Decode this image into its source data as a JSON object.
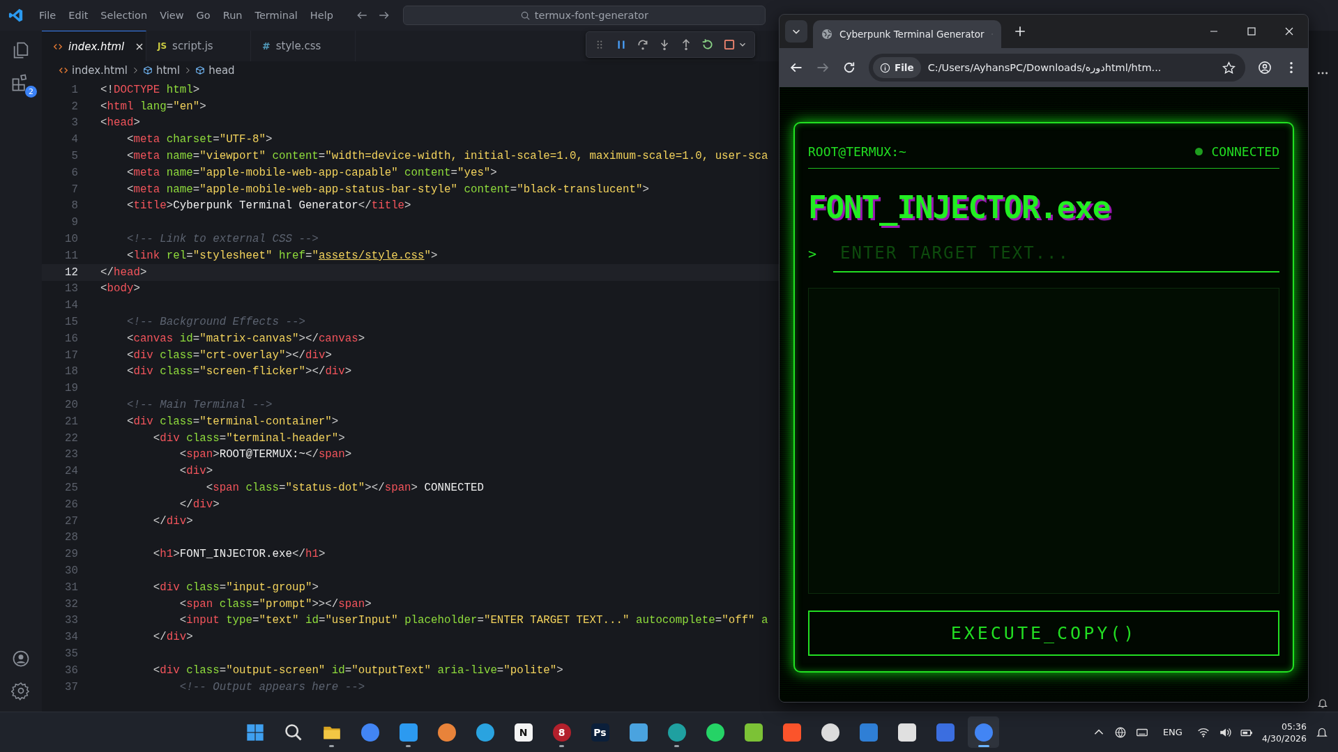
{
  "titlebar": {
    "menu": [
      "File",
      "Edit",
      "Selection",
      "View",
      "Go",
      "Run",
      "Terminal",
      "Help"
    ],
    "search": "termux-font-generator"
  },
  "activity_bar": {
    "extensions_badge": "2"
  },
  "editor_tabs": [
    {
      "kind": "html",
      "label": "index.html",
      "selected": true
    },
    {
      "kind": "js",
      "icon_text": "JS",
      "label": "script.js",
      "selected": false
    },
    {
      "kind": "css",
      "icon_text": "#",
      "label": "style.css",
      "selected": false
    }
  ],
  "breadcrumb": [
    "index.html",
    "html",
    "head"
  ],
  "code_lines": [
    {
      "number": "1",
      "current": false,
      "tokens": [
        {
          "kind": "punct",
          "text": "<!"
        },
        {
          "kind": "tag",
          "text": "DOCTYPE"
        },
        {
          "kind": "attr",
          "text": " html"
        },
        {
          "kind": "punct",
          "text": ">"
        }
      ]
    },
    {
      "number": "2",
      "current": false,
      "tokens": [
        {
          "kind": "punct",
          "text": "<"
        },
        {
          "kind": "tag",
          "text": "html"
        },
        {
          "kind": "attr",
          "text": " lang"
        },
        {
          "kind": "punct",
          "text": "="
        },
        {
          "kind": "string",
          "text": "\"en\""
        },
        {
          "kind": "punct",
          "text": ">"
        }
      ]
    },
    {
      "number": "3",
      "current": false,
      "tokens": [
        {
          "kind": "punct",
          "text": "<"
        },
        {
          "kind": "tag",
          "text": "head"
        },
        {
          "kind": "punct",
          "text": ">"
        }
      ]
    },
    {
      "number": "4",
      "current": false,
      "tokens": [
        {
          "kind": "punct",
          "text": "    <"
        },
        {
          "kind": "tag",
          "text": "meta"
        },
        {
          "kind": "attr",
          "text": " charset"
        },
        {
          "kind": "punct",
          "text": "="
        },
        {
          "kind": "string",
          "text": "\"UTF-8\""
        },
        {
          "kind": "punct",
          "text": ">"
        }
      ]
    },
    {
      "number": "5",
      "current": false,
      "tokens": [
        {
          "kind": "punct",
          "text": "    <"
        },
        {
          "kind": "tag",
          "text": "meta"
        },
        {
          "kind": "attr",
          "text": " name"
        },
        {
          "kind": "punct",
          "text": "="
        },
        {
          "kind": "string",
          "text": "\"viewport\""
        },
        {
          "kind": "attr",
          "text": " content"
        },
        {
          "kind": "punct",
          "text": "="
        },
        {
          "kind": "string",
          "text": "\"width=device-width, initial-scale=1.0, maximum-scale=1.0, user-sca"
        }
      ]
    },
    {
      "number": "6",
      "current": false,
      "tokens": [
        {
          "kind": "punct",
          "text": "    <"
        },
        {
          "kind": "tag",
          "text": "meta"
        },
        {
          "kind": "attr",
          "text": " name"
        },
        {
          "kind": "punct",
          "text": "="
        },
        {
          "kind": "string",
          "text": "\"apple-mobile-web-app-capable\""
        },
        {
          "kind": "attr",
          "text": " content"
        },
        {
          "kind": "punct",
          "text": "="
        },
        {
          "kind": "string",
          "text": "\"yes\""
        },
        {
          "kind": "punct",
          "text": ">"
        }
      ]
    },
    {
      "number": "7",
      "current": false,
      "tokens": [
        {
          "kind": "punct",
          "text": "    <"
        },
        {
          "kind": "tag",
          "text": "meta"
        },
        {
          "kind": "attr",
          "text": " name"
        },
        {
          "kind": "punct",
          "text": "="
        },
        {
          "kind": "string",
          "text": "\"apple-mobile-web-app-status-bar-style\""
        },
        {
          "kind": "attr",
          "text": " content"
        },
        {
          "kind": "punct",
          "text": "="
        },
        {
          "kind": "string",
          "text": "\"black-translucent\""
        },
        {
          "kind": "punct",
          "text": ">"
        }
      ]
    },
    {
      "number": "8",
      "current": false,
      "tokens": [
        {
          "kind": "punct",
          "text": "    <"
        },
        {
          "kind": "tag",
          "text": "title"
        },
        {
          "kind": "punct",
          "text": ">"
        },
        {
          "kind": "text",
          "text": "Cyberpunk Terminal Generator"
        },
        {
          "kind": "punct",
          "text": "</"
        },
        {
          "kind": "tag",
          "text": "title"
        },
        {
          "kind": "punct",
          "text": ">"
        }
      ]
    },
    {
      "number": "9",
      "current": false
    },
    {
      "number": "10",
      "current": false,
      "tokens": [
        {
          "kind": "comment",
          "text": "    <!-- Link to external CSS -->"
        }
      ]
    },
    {
      "number": "11",
      "current": false,
      "tokens": [
        {
          "kind": "punct",
          "text": "    <"
        },
        {
          "kind": "tag",
          "text": "link"
        },
        {
          "kind": "attr",
          "text": " rel"
        },
        {
          "kind": "punct",
          "text": "="
        },
        {
          "kind": "string",
          "text": "\"stylesheet\""
        },
        {
          "kind": "attr",
          "text": " href"
        },
        {
          "kind": "punct",
          "text": "="
        },
        {
          "kind": "string",
          "text": "\""
        },
        {
          "kind": "link",
          "text": "assets/style.css"
        },
        {
          "kind": "string",
          "text": "\""
        },
        {
          "kind": "punct",
          "text": ">"
        }
      ]
    },
    {
      "number": "12",
      "current": true,
      "tokens": [
        {
          "kind": "punct",
          "text": "</"
        },
        {
          "kind": "tag",
          "text": "head"
        },
        {
          "kind": "punct",
          "text": ">"
        }
      ]
    },
    {
      "number": "13",
      "current": false,
      "tokens": [
        {
          "kind": "punct",
          "text": "<"
        },
        {
          "kind": "tag",
          "text": "body"
        },
        {
          "kind": "punct",
          "text": ">"
        }
      ]
    },
    {
      "number": "14",
      "current": false
    },
    {
      "number": "15",
      "current": false,
      "tokens": [
        {
          "kind": "comment",
          "text": "    <!-- Background Effects -->"
        }
      ]
    },
    {
      "number": "16",
      "current": false,
      "tokens": [
        {
          "kind": "punct",
          "text": "    <"
        },
        {
          "kind": "tag",
          "text": "canvas"
        },
        {
          "kind": "attr",
          "text": " id"
        },
        {
          "kind": "punct",
          "text": "="
        },
        {
          "kind": "string",
          "text": "\"matrix-canvas\""
        },
        {
          "kind": "punct",
          "text": "></"
        },
        {
          "kind": "tag",
          "text": "canvas"
        },
        {
          "kind": "punct",
          "text": ">"
        }
      ]
    },
    {
      "number": "17",
      "current": false,
      "tokens": [
        {
          "kind": "punct",
          "text": "    <"
        },
        {
          "kind": "tag",
          "text": "div"
        },
        {
          "kind": "attr",
          "text": " class"
        },
        {
          "kind": "punct",
          "text": "="
        },
        {
          "kind": "string",
          "text": "\"crt-overlay\""
        },
        {
          "kind": "punct",
          "text": "></"
        },
        {
          "kind": "tag",
          "text": "div"
        },
        {
          "kind": "punct",
          "text": ">"
        }
      ]
    },
    {
      "number": "18",
      "current": false,
      "tokens": [
        {
          "kind": "punct",
          "text": "    <"
        },
        {
          "kind": "tag",
          "text": "div"
        },
        {
          "kind": "attr",
          "text": " class"
        },
        {
          "kind": "punct",
          "text": "="
        },
        {
          "kind": "string",
          "text": "\"screen-flicker\""
        },
        {
          "kind": "punct",
          "text": "></"
        },
        {
          "kind": "tag",
          "text": "div"
        },
        {
          "kind": "punct",
          "text": ">"
        }
      ]
    },
    {
      "number": "19",
      "current": false
    },
    {
      "number": "20",
      "current": false,
      "tokens": [
        {
          "kind": "comment",
          "text": "    <!-- Main Terminal -->"
        }
      ]
    },
    {
      "number": "21",
      "current": false,
      "tokens": [
        {
          "kind": "punct",
          "text": "    <"
        },
        {
          "kind": "tag",
          "text": "div"
        },
        {
          "kind": "attr",
          "text": " class"
        },
        {
          "kind": "punct",
          "text": "="
        },
        {
          "kind": "string",
          "text": "\"terminal-container\""
        },
        {
          "kind": "punct",
          "text": ">"
        }
      ]
    },
    {
      "number": "22",
      "current": false,
      "tokens": [
        {
          "kind": "punct",
          "text": "        <"
        },
        {
          "kind": "tag",
          "text": "div"
        },
        {
          "kind": "attr",
          "text": " class"
        },
        {
          "kind": "punct",
          "text": "="
        },
        {
          "kind": "string",
          "text": "\"terminal-header\""
        },
        {
          "kind": "punct",
          "text": ">"
        }
      ]
    },
    {
      "number": "23",
      "current": false,
      "tokens": [
        {
          "kind": "punct",
          "text": "            <"
        },
        {
          "kind": "tag",
          "text": "span"
        },
        {
          "kind": "punct",
          "text": ">"
        },
        {
          "kind": "text",
          "text": "ROOT@TERMUX:~"
        },
        {
          "kind": "punct",
          "text": "</"
        },
        {
          "kind": "tag",
          "text": "span"
        },
        {
          "kind": "punct",
          "text": ">"
        }
      ]
    },
    {
      "number": "24",
      "current": false,
      "tokens": [
        {
          "kind": "punct",
          "text": "            <"
        },
        {
          "kind": "tag",
          "text": "div"
        },
        {
          "kind": "punct",
          "text": ">"
        }
      ]
    },
    {
      "number": "25",
      "current": false,
      "tokens": [
        {
          "kind": "punct",
          "text": "                <"
        },
        {
          "kind": "tag",
          "text": "span"
        },
        {
          "kind": "attr",
          "text": " class"
        },
        {
          "kind": "punct",
          "text": "="
        },
        {
          "kind": "string",
          "text": "\"status-dot\""
        },
        {
          "kind": "punct",
          "text": "></"
        },
        {
          "kind": "tag",
          "text": "span"
        },
        {
          "kind": "punct",
          "text": ">"
        },
        {
          "kind": "text",
          "text": " CONNECTED"
        }
      ]
    },
    {
      "number": "26",
      "current": false,
      "tokens": [
        {
          "kind": "punct",
          "text": "            </"
        },
        {
          "kind": "tag",
          "text": "div"
        },
        {
          "kind": "punct",
          "text": ">"
        }
      ]
    },
    {
      "number": "27",
      "current": false,
      "tokens": [
        {
          "kind": "punct",
          "text": "        </"
        },
        {
          "kind": "tag",
          "text": "div"
        },
        {
          "kind": "punct",
          "text": ">"
        }
      ]
    },
    {
      "number": "28",
      "current": false
    },
    {
      "number": "29",
      "current": false,
      "tokens": [
        {
          "kind": "punct",
          "text": "        <"
        },
        {
          "kind": "tag",
          "text": "h1"
        },
        {
          "kind": "punct",
          "text": ">"
        },
        {
          "kind": "text",
          "text": "FONT_INJECTOR.exe"
        },
        {
          "kind": "punct",
          "text": "</"
        },
        {
          "kind": "tag",
          "text": "h1"
        },
        {
          "kind": "punct",
          "text": ">"
        }
      ]
    },
    {
      "number": "30",
      "current": false
    },
    {
      "number": "31",
      "current": false,
      "tokens": [
        {
          "kind": "punct",
          "text": "        <"
        },
        {
          "kind": "tag",
          "text": "div"
        },
        {
          "kind": "attr",
          "text": " class"
        },
        {
          "kind": "punct",
          "text": "="
        },
        {
          "kind": "string",
          "text": "\"input-group\""
        },
        {
          "kind": "punct",
          "text": ">"
        }
      ]
    },
    {
      "number": "32",
      "current": false,
      "tokens": [
        {
          "kind": "punct",
          "text": "            <"
        },
        {
          "kind": "tag",
          "text": "span"
        },
        {
          "kind": "attr",
          "text": " class"
        },
        {
          "kind": "punct",
          "text": "="
        },
        {
          "kind": "string",
          "text": "\"prompt\""
        },
        {
          "kind": "punct",
          "text": ">></"
        },
        {
          "kind": "tag",
          "text": "span"
        },
        {
          "kind": "punct",
          "text": ">"
        }
      ]
    },
    {
      "number": "33",
      "current": false,
      "tokens": [
        {
          "kind": "punct",
          "text": "            <"
        },
        {
          "kind": "tag",
          "text": "input"
        },
        {
          "kind": "attr",
          "text": " type"
        },
        {
          "kind": "punct",
          "text": "="
        },
        {
          "kind": "string",
          "text": "\"text\""
        },
        {
          "kind": "attr",
          "text": " id"
        },
        {
          "kind": "punct",
          "text": "="
        },
        {
          "kind": "string",
          "text": "\"userInput\""
        },
        {
          "kind": "attr",
          "text": " placeholder"
        },
        {
          "kind": "punct",
          "text": "="
        },
        {
          "kind": "string",
          "text": "\"ENTER TARGET TEXT...\""
        },
        {
          "kind": "attr",
          "text": " autocomplete"
        },
        {
          "kind": "punct",
          "text": "="
        },
        {
          "kind": "string",
          "text": "\"off\""
        },
        {
          "kind": "attr",
          "text": " a"
        }
      ]
    },
    {
      "number": "34",
      "current": false,
      "tokens": [
        {
          "kind": "punct",
          "text": "        </"
        },
        {
          "kind": "tag",
          "text": "div"
        },
        {
          "kind": "punct",
          "text": ">"
        }
      ]
    },
    {
      "number": "35",
      "current": false
    },
    {
      "number": "36",
      "current": false,
      "tokens": [
        {
          "kind": "punct",
          "text": "        <"
        },
        {
          "kind": "tag",
          "text": "div"
        },
        {
          "kind": "attr",
          "text": " class"
        },
        {
          "kind": "punct",
          "text": "="
        },
        {
          "kind": "string",
          "text": "\"output-screen\""
        },
        {
          "kind": "attr",
          "text": " id"
        },
        {
          "kind": "punct",
          "text": "="
        },
        {
          "kind": "string",
          "text": "\"outputText\""
        },
        {
          "kind": "attr",
          "text": " aria-live"
        },
        {
          "kind": "punct",
          "text": "="
        },
        {
          "kind": "string",
          "text": "\"polite\""
        },
        {
          "kind": "punct",
          "text": ">"
        }
      ]
    },
    {
      "number": "37",
      "current": false,
      "tokens": [
        {
          "kind": "comment",
          "text": "            <!-- Output appears here -->"
        }
      ]
    }
  ],
  "browser": {
    "tab_title": "Cyberpunk Terminal Generator",
    "url_chip": "File",
    "url": "C:/Users/AyhansPC/Downloads/دورهhtml/htm...",
    "terminal": {
      "user": "ROOT@TERMUX:~",
      "status": "CONNECTED",
      "connected": true,
      "title": "FONT_INJECTOR.exe",
      "prompt": ">",
      "placeholder": "ENTER TARGET TEXT...",
      "button": "EXECUTE_COPY()"
    }
  },
  "taskbar": {
    "apps": [
      {
        "kind": "start",
        "running": false,
        "selected": false
      },
      {
        "kind": "search",
        "running": false,
        "selected": false
      },
      {
        "kind": "folder",
        "color": "#f2c744",
        "running": true,
        "selected": false
      },
      {
        "kind": "round",
        "color": "#4285f4",
        "running": false,
        "selected": false
      },
      {
        "kind": "tile",
        "color": "#2c9af0",
        "running": true,
        "selected": false
      },
      {
        "kind": "round",
        "color": "#e8833a",
        "running": false,
        "selected": false
      },
      {
        "kind": "round",
        "color": "#2aa3e0",
        "running": false,
        "selected": false
      },
      {
        "kind": "tile",
        "color": "#f4f4f4",
        "glyph": "N",
        "running": false,
        "selected": false
      },
      {
        "kind": "round",
        "color": "#b3202c",
        "glyph": "8",
        "running": true,
        "selected": false
      },
      {
        "kind": "tile",
        "color": "#0b1f3a",
        "glyph": "Ps",
        "running": false,
        "selected": false
      },
      {
        "kind": "tile",
        "color": "#4aa3df",
        "running": false,
        "selected": false
      },
      {
        "kind": "round",
        "color": "#1fa0a0",
        "running": true,
        "selected": false
      },
      {
        "kind": "round",
        "color": "#25d366",
        "running": false,
        "selected": false
      },
      {
        "kind": "tile",
        "color": "#7cc236",
        "running": false,
        "selected": false
      },
      {
        "kind": "tile",
        "color": "#fb542b",
        "running": false,
        "selected": false
      },
      {
        "kind": "round",
        "color": "#dcdcdc",
        "running": false,
        "selected": false
      },
      {
        "kind": "tile",
        "color": "#2f7fd6",
        "running": false,
        "selected": false
      },
      {
        "kind": "tile",
        "color": "#e0e0e0",
        "running": false,
        "selected": false
      },
      {
        "kind": "tile",
        "color": "#3b6ee0",
        "running": false,
        "selected": false
      },
      {
        "kind": "round",
        "color": "#4285f4",
        "running": true,
        "selected": true
      }
    ],
    "language": "ENG",
    "time": "05:36",
    "date": "4/30/2026"
  }
}
